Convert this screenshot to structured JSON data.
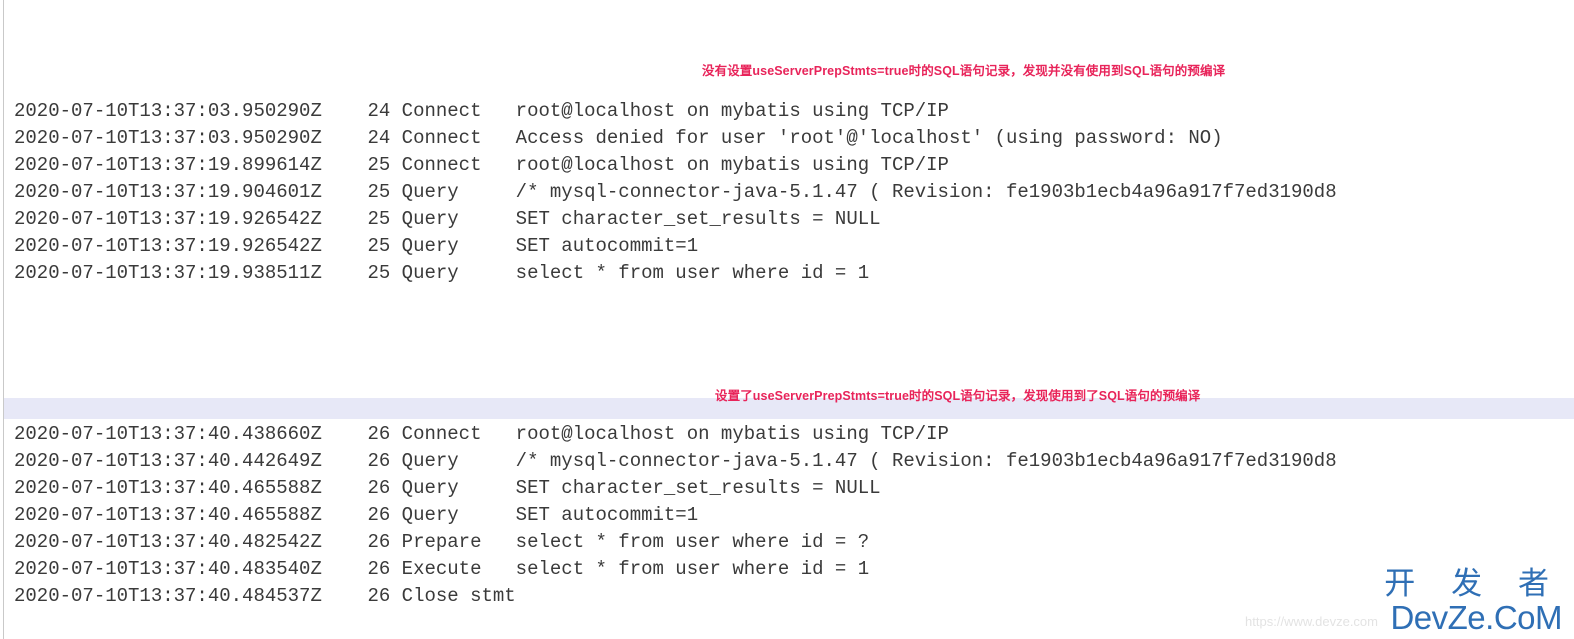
{
  "page": {
    "background_color": "#ffffff",
    "left_rule_color": "#c9c9c9",
    "highlight_band_color": "#e7e8f7",
    "log_text_color": "#3a3a3a",
    "annotation_color": "#e8245a",
    "watermark_color": "#2f6fb5"
  },
  "annotations": {
    "first": "没有设置useServerPrepStmts=true时的SQL语句记录，发现并没有使用到SQL语句的预编译",
    "second": "设置了useServerPrepStmts=true时的SQL语句记录，发现使用到了SQL语句的预编译"
  },
  "log_block_1": {
    "lines": [
      "2020-07-10T13:37:03.950290Z    24 Connect\troot@localhost on mybatis using TCP/IP",
      "2020-07-10T13:37:03.950290Z    24 Connect\tAccess denied for user 'root'@'localhost' (using password: NO)",
      "2020-07-10T13:37:19.899614Z    25 Connect\troot@localhost on mybatis using TCP/IP",
      "2020-07-10T13:37:19.904601Z    25 Query\t/* mysql-connector-java-5.1.47 ( Revision: fe1903b1ecb4a96a917f7ed3190d8",
      "2020-07-10T13:37:19.926542Z    25 Query\tSET character_set_results = NULL",
      "2020-07-10T13:37:19.926542Z    25 Query\tSET autocommit=1",
      "2020-07-10T13:37:19.938511Z    25 Query\tselect * from user where id = 1"
    ],
    "entries": [
      {
        "timestamp": "2020-07-10T13:37:03.950290Z",
        "id": "24",
        "command": "Connect",
        "argument": "root@localhost on mybatis using TCP/IP"
      },
      {
        "timestamp": "2020-07-10T13:37:03.950290Z",
        "id": "24",
        "command": "Connect",
        "argument": "Access denied for user 'root'@'localhost' (using password: NO)"
      },
      {
        "timestamp": "2020-07-10T13:37:19.899614Z",
        "id": "25",
        "command": "Connect",
        "argument": "root@localhost on mybatis using TCP/IP"
      },
      {
        "timestamp": "2020-07-10T13:37:19.904601Z",
        "id": "25",
        "command": "Query",
        "argument": "/* mysql-connector-java-5.1.47 ( Revision: fe1903b1ecb4a96a917f7ed3190d8"
      },
      {
        "timestamp": "2020-07-10T13:37:19.926542Z",
        "id": "25",
        "command": "Query",
        "argument": "SET character_set_results = NULL"
      },
      {
        "timestamp": "2020-07-10T13:37:19.926542Z",
        "id": "25",
        "command": "Query",
        "argument": "SET autocommit=1"
      },
      {
        "timestamp": "2020-07-10T13:37:19.938511Z",
        "id": "25",
        "command": "Query",
        "argument": "select * from user where id = 1"
      }
    ]
  },
  "log_block_2": {
    "lines": [
      "2020-07-10T13:37:40.438660Z    26 Connect\troot@localhost on mybatis using TCP/IP",
      "2020-07-10T13:37:40.442649Z    26 Query\t/* mysql-connector-java-5.1.47 ( Revision: fe1903b1ecb4a96a917f7ed3190d8",
      "2020-07-10T13:37:40.465588Z    26 Query\tSET character_set_results = NULL",
      "2020-07-10T13:37:40.465588Z    26 Query\tSET autocommit=1",
      "2020-07-10T13:37:40.482542Z    26 Prepare\tselect * from user where id = ?",
      "2020-07-10T13:37:40.483540Z    26 Execute\tselect * from user where id = 1",
      "2020-07-10T13:37:40.484537Z    26 Close stmt"
    ],
    "entries": [
      {
        "timestamp": "2020-07-10T13:37:40.438660Z",
        "id": "26",
        "command": "Connect",
        "argument": "root@localhost on mybatis using TCP/IP"
      },
      {
        "timestamp": "2020-07-10T13:37:40.442649Z",
        "id": "26",
        "command": "Query",
        "argument": "/* mysql-connector-java-5.1.47 ( Revision: fe1903b1ecb4a96a917f7ed3190d8"
      },
      {
        "timestamp": "2020-07-10T13:37:40.465588Z",
        "id": "26",
        "command": "Query",
        "argument": "SET character_set_results = NULL"
      },
      {
        "timestamp": "2020-07-10T13:37:40.465588Z",
        "id": "26",
        "command": "Query",
        "argument": "SET autocommit=1"
      },
      {
        "timestamp": "2020-07-10T13:37:40.482542Z",
        "id": "26",
        "command": "Prepare",
        "argument": "select * from user where id = ?"
      },
      {
        "timestamp": "2020-07-10T13:37:40.483540Z",
        "id": "26",
        "command": "Execute",
        "argument": "select * from user where id = 1"
      },
      {
        "timestamp": "2020-07-10T13:37:40.484537Z",
        "id": "26",
        "command": "Close stmt",
        "argument": ""
      }
    ]
  },
  "watermark": {
    "chinese": "开 发 者",
    "english": "DevZe.CoM",
    "url": "https://www.devze.com"
  }
}
